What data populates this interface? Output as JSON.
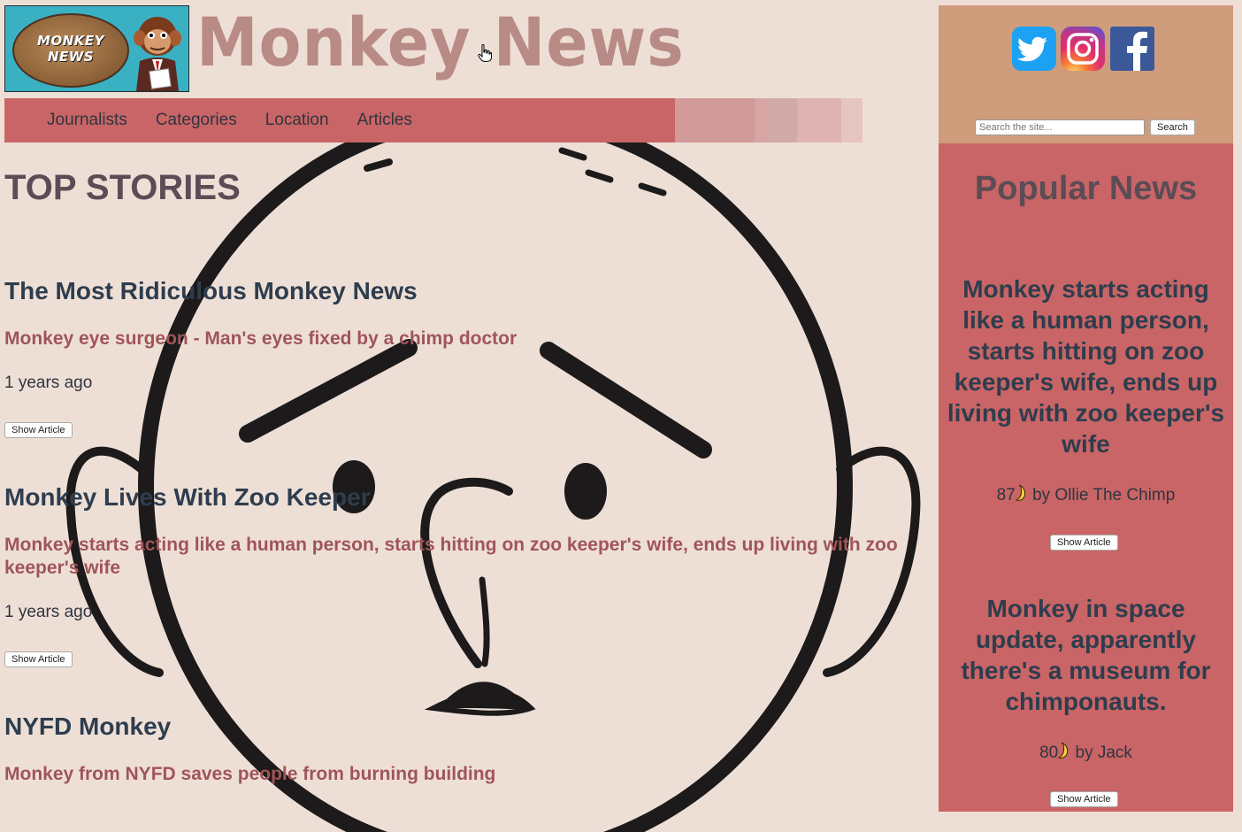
{
  "header": {
    "logo_text_line1": "MONKEY",
    "logo_text_line2": "NEWS",
    "site_title": "Monkey News"
  },
  "nav": {
    "items": [
      "Journalists",
      "Categories",
      "Location",
      "Articles"
    ]
  },
  "main": {
    "heading": "TOP STORIES",
    "stories": [
      {
        "title": "The Most Ridiculous Monkey News",
        "subtitle": "Monkey eye surgeon - Man's eyes fixed by a chimp doctor",
        "time": "1 years ago",
        "button": "Show Article"
      },
      {
        "title": "Monkey Lives With Zoo Keeper",
        "subtitle": "Monkey starts acting like a human person, starts hitting on zoo keeper's wife, ends up living with zoo keeper's wife",
        "time": "1 years ago",
        "button": "Show Article"
      },
      {
        "title": "NYFD Monkey",
        "subtitle": "Monkey from NYFD saves people from burning building"
      }
    ]
  },
  "sidebar": {
    "social": [
      "twitter-icon",
      "instagram-icon",
      "facebook-icon"
    ],
    "search_placeholder": "Search the site...",
    "search_button": "Search",
    "popular_heading": "Popular News",
    "popular": [
      {
        "title": "Monkey starts acting like a human person, starts hitting on zoo keeper's wife, ends up living with zoo keeper's wife",
        "count": "87",
        "author": " by Ollie The Chimp",
        "button": "Show Article"
      },
      {
        "title": "Monkey in space update, apparently there's a museum for chimponauts.",
        "count": "80",
        "author": " by Jack",
        "button": "Show Article"
      }
    ]
  },
  "colors": {
    "background": "#eedfd6",
    "nav": "#c96566",
    "sidebar_top": "#cf9c7c",
    "sidebar": "#c96566",
    "title": "#b98b86"
  }
}
